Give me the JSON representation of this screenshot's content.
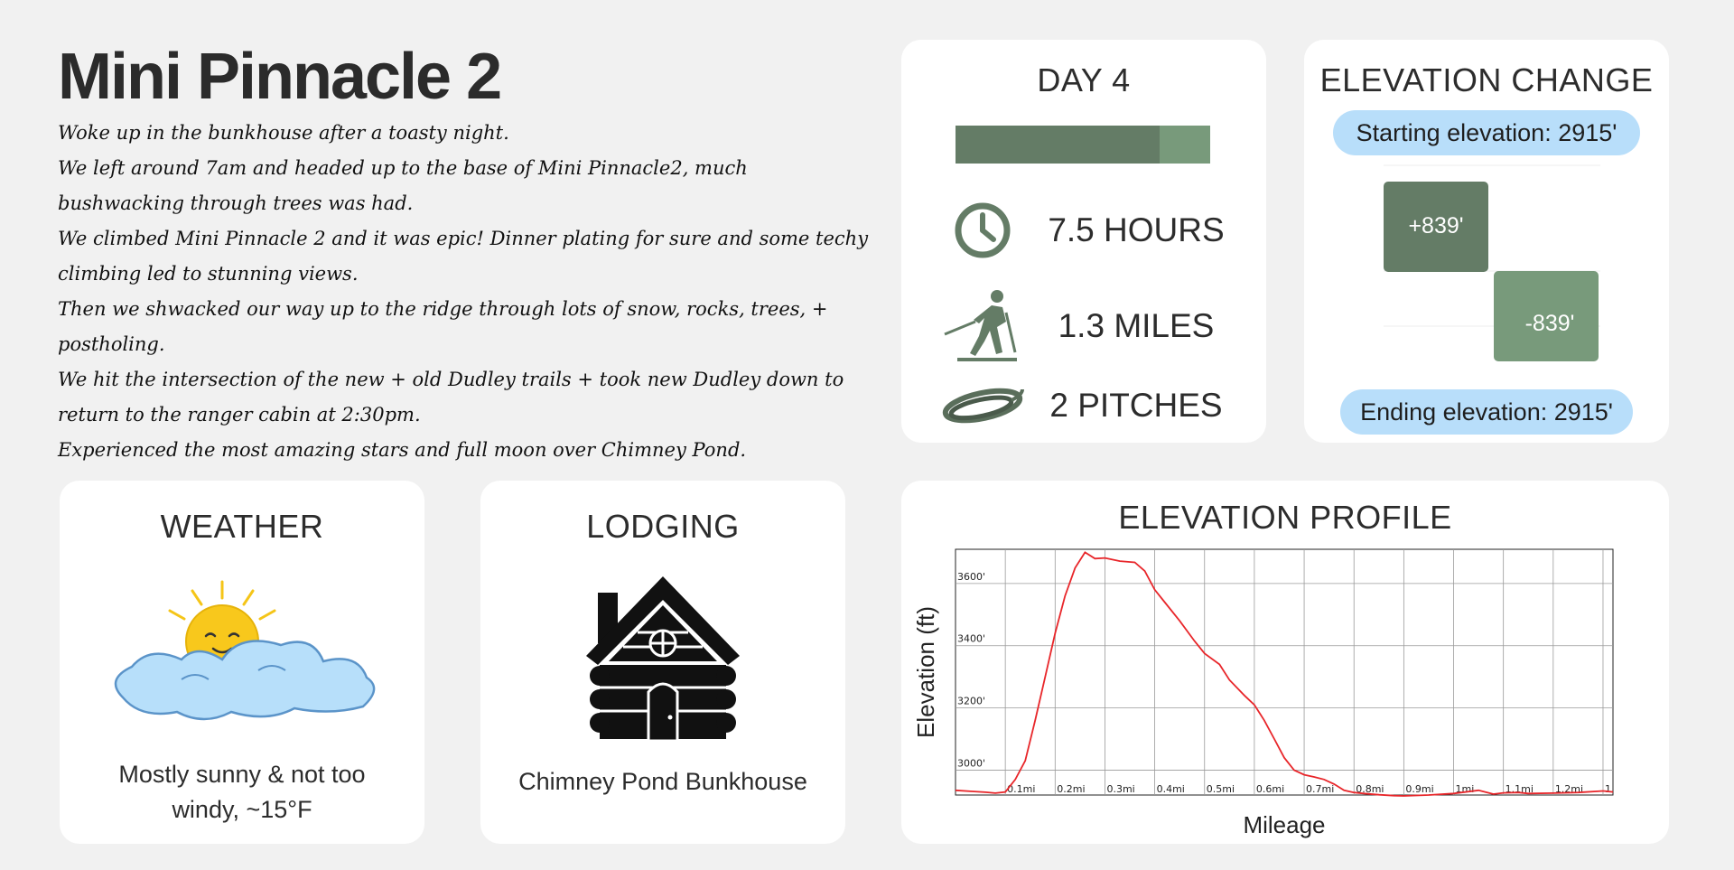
{
  "title": "Mini Pinnacle 2",
  "journal": [
    "Woke up in the bunkhouse after a toasty night.",
    "We left around 7am and headed up to the base of Mini Pinnacle2, much bushwacking through trees was had.",
    "We climbed Mini Pinnacle 2 and it was epic! Dinner plating for sure and some techy climbing led to stunning views.",
    "Then we shwacked our way up to the ridge through lots of snow, rocks, trees, + postholing.",
    "We hit the intersection of the new + old Dudley trails + took new Dudley down to return to the ranger cabin at 2:30pm.",
    "Experienced the most amazing stars and full moon over Chimney Pond."
  ],
  "day": {
    "title": "DAY 4",
    "progress": 0.8,
    "stats": [
      {
        "icon": "clock-icon",
        "text": "7.5 HOURS"
      },
      {
        "icon": "skier-icon",
        "text": "1.3 MILES"
      },
      {
        "icon": "rope-icon",
        "text": "2 PITCHES"
      }
    ]
  },
  "elevation_change": {
    "title": "ELEVATION CHANGE",
    "start": "Starting elevation: 2915'",
    "end": "Ending elevation: 2915'",
    "gain_label": "+839'",
    "loss_label": "-839'",
    "gain": 839,
    "loss": 839
  },
  "weather": {
    "title": "WEATHER",
    "icon": "sun-cloud-icon",
    "text": "Mostly sunny & not too windy, ~15°F"
  },
  "lodging": {
    "title": "LODGING",
    "icon": "cabin-icon",
    "text": "Chimney Pond Bunkhouse"
  },
  "profile": {
    "title": "ELEVATION PROFILE"
  },
  "colors": {
    "background": "#f1f1f1",
    "card": "#ffffff",
    "dark_green": "#647c66",
    "light_green": "#789a7b",
    "pill_blue": "#b8defa",
    "profile_line": "#e8262a"
  },
  "chart_data": {
    "type": "line",
    "title": "ELEVATION PROFILE",
    "xlabel": "Mileage",
    "ylabel": "Elevation (ft)",
    "x_ticks": [
      "0.1mi",
      "0.2mi",
      "0.3mi",
      "0.4mi",
      "0.5mi",
      "0.6mi",
      "0.7mi",
      "0.8mi",
      "0.9mi",
      "1mi",
      "1.1mi",
      "1.2mi",
      "1."
    ],
    "y_ticks": [
      "3000'",
      "3200'",
      "3400'",
      "3600'"
    ],
    "xlim": [
      0,
      1.32
    ],
    "ylim": [
      2920,
      3710
    ],
    "grid": true,
    "series": [
      {
        "x": [
          0,
          0.03,
          0.06,
          0.08,
          0.1,
          0.12,
          0.14,
          0.16,
          0.18,
          0.2,
          0.22,
          0.24,
          0.26,
          0.28,
          0.3,
          0.33,
          0.36,
          0.38,
          0.4,
          0.42,
          0.45,
          0.48,
          0.5,
          0.53,
          0.55,
          0.58,
          0.6,
          0.62,
          0.64,
          0.66,
          0.68,
          0.7,
          0.72,
          0.74,
          0.76,
          0.78,
          0.8,
          0.82,
          0.85,
          0.88,
          0.9,
          0.95,
          1.0,
          1.05,
          1.08,
          1.1,
          1.13,
          1.15,
          1.2,
          1.25,
          1.3,
          1.32
        ],
        "y": [
          2935,
          2932,
          2929,
          2926,
          2930,
          2970,
          3030,
          3160,
          3300,
          3440,
          3560,
          3650,
          3700,
          3680,
          3682,
          3672,
          3668,
          3640,
          3580,
          3540,
          3480,
          3415,
          3375,
          3340,
          3290,
          3240,
          3210,
          3160,
          3100,
          3040,
          3000,
          2985,
          2978,
          2970,
          2955,
          2935,
          2928,
          2925,
          2921,
          2918,
          2917,
          2920,
          2925,
          2935,
          2923,
          2927,
          2928,
          2925,
          2926,
          2928,
          2933,
          2930
        ]
      }
    ]
  }
}
